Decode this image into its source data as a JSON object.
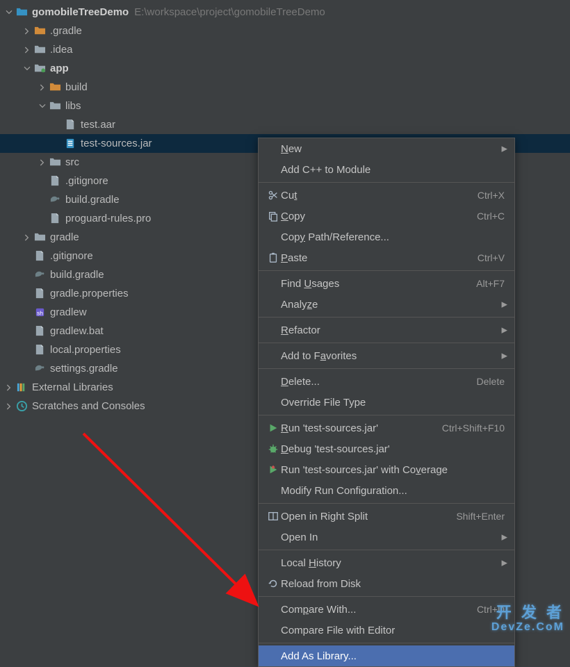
{
  "tree": {
    "root": {
      "name": "gomobileTreeDemo",
      "path": "E:\\workspace\\project\\gomobileTreeDemo"
    },
    "items": [
      {
        "indent": 1,
        "chevron": "right",
        "icon": "folder-orange",
        "label": ".gradle"
      },
      {
        "indent": 1,
        "chevron": "right",
        "icon": "folder-grey",
        "label": ".idea"
      },
      {
        "indent": 1,
        "chevron": "down",
        "icon": "folder-module",
        "label": "app",
        "bold": true
      },
      {
        "indent": 2,
        "chevron": "right",
        "icon": "folder-orange",
        "label": "build"
      },
      {
        "indent": 2,
        "chevron": "down",
        "icon": "folder-grey",
        "label": "libs"
      },
      {
        "indent": 3,
        "chevron": "",
        "icon": "file",
        "label": "test.aar"
      },
      {
        "indent": 3,
        "chevron": "",
        "icon": "jar",
        "label": "test-sources.jar",
        "selected": true
      },
      {
        "indent": 2,
        "chevron": "right",
        "icon": "folder-grey",
        "label": "src"
      },
      {
        "indent": 2,
        "chevron": "",
        "icon": "file",
        "label": ".gitignore"
      },
      {
        "indent": 2,
        "chevron": "",
        "icon": "gradle",
        "label": "build.gradle"
      },
      {
        "indent": 2,
        "chevron": "",
        "icon": "file",
        "label": "proguard-rules.pro"
      },
      {
        "indent": 1,
        "chevron": "right",
        "icon": "folder-grey",
        "label": "gradle"
      },
      {
        "indent": 1,
        "chevron": "",
        "icon": "file",
        "label": ".gitignore"
      },
      {
        "indent": 1,
        "chevron": "",
        "icon": "gradle",
        "label": "build.gradle"
      },
      {
        "indent": 1,
        "chevron": "",
        "icon": "file",
        "label": "gradle.properties"
      },
      {
        "indent": 1,
        "chevron": "",
        "icon": "file-exec",
        "label": "gradlew"
      },
      {
        "indent": 1,
        "chevron": "",
        "icon": "file",
        "label": "gradlew.bat"
      },
      {
        "indent": 1,
        "chevron": "",
        "icon": "file",
        "label": "local.properties"
      },
      {
        "indent": 1,
        "chevron": "",
        "icon": "gradle",
        "label": "settings.gradle"
      }
    ],
    "external": "External Libraries",
    "scratches": "Scratches and Consoles"
  },
  "ctx": {
    "groups": [
      [
        {
          "icon": "",
          "html": "<u>N</u>ew",
          "sub": true
        },
        {
          "icon": "",
          "html": "Add C++ to Module"
        }
      ],
      [
        {
          "icon": "scissors",
          "html": "Cu<u>t</u>",
          "shortcut": "Ctrl+X"
        },
        {
          "icon": "copy",
          "html": "<u>C</u>opy",
          "shortcut": "Ctrl+C"
        },
        {
          "icon": "",
          "html": "Cop<u>y</u> Path/Reference..."
        },
        {
          "icon": "paste",
          "html": "<u>P</u>aste",
          "shortcut": "Ctrl+V"
        }
      ],
      [
        {
          "icon": "",
          "html": "Find <u>U</u>sages",
          "shortcut": "Alt+F7"
        },
        {
          "icon": "",
          "html": "Analy<u>z</u>e",
          "sub": true
        }
      ],
      [
        {
          "icon": "",
          "html": "<u>R</u>efactor",
          "sub": true
        }
      ],
      [
        {
          "icon": "",
          "html": "Add to F<u>a</u>vorites",
          "sub": true
        }
      ],
      [
        {
          "icon": "",
          "html": "<u>D</u>elete...",
          "shortcut": "Delete"
        },
        {
          "icon": "",
          "html": "Override File Type"
        }
      ],
      [
        {
          "icon": "run",
          "html": "<u>R</u>un 'test-sources.jar'",
          "shortcut": "Ctrl+Shift+F10"
        },
        {
          "icon": "debug",
          "html": "<u>D</u>ebug 'test-sources.jar'"
        },
        {
          "icon": "coverage",
          "html": "Run 'test-sources.jar' with Co<u>v</u>erage"
        },
        {
          "icon": "",
          "html": "Modify Run Configuration..."
        }
      ],
      [
        {
          "icon": "split",
          "html": "Open in Right Split",
          "shortcut": "Shift+Enter"
        },
        {
          "icon": "",
          "html": "Open In",
          "sub": true
        }
      ],
      [
        {
          "icon": "",
          "html": "Local <u>H</u>istory",
          "sub": true
        },
        {
          "icon": "reload",
          "html": "Reload from Disk"
        }
      ],
      [
        {
          "icon": "",
          "html": "Com<u>p</u>are With...",
          "shortcut": "Ctrl+D"
        },
        {
          "icon": "",
          "html": "Compare File with Editor"
        }
      ],
      [
        {
          "icon": "",
          "html": "Add As Library...",
          "highlight": true
        }
      ]
    ]
  },
  "watermark": {
    "line1": "开 发 者",
    "line2": "DevZe.CoM"
  }
}
